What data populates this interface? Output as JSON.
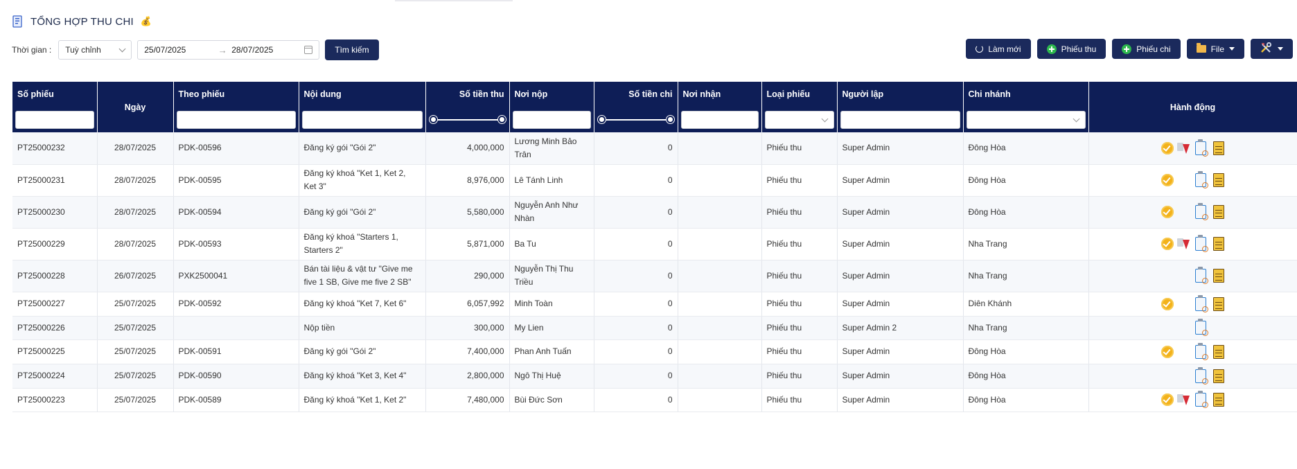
{
  "page": {
    "title": "TỔNG HỢP THU CHI",
    "title_emoji": "💰"
  },
  "filter": {
    "label": "Thời gian :",
    "period": "Tuỳ chỉnh",
    "date_from": "25/07/2025",
    "date_to": "28/07/2025",
    "arrow": "→",
    "search_label": "Tìm kiếm"
  },
  "toolbar": {
    "refresh_label": "Làm mới",
    "receipt_label": "Phiếu thu",
    "payment_label": "Phiếu chi",
    "file_label": "File"
  },
  "table": {
    "columns": [
      "Số phiếu",
      "Ngày",
      "Theo phiếu",
      "Nội dung",
      "Số tiền thu",
      "Nơi nộp",
      "Số tiền chi",
      "Nơi nhận",
      "Loại phiếu",
      "Người lập",
      "Chi nhánh",
      "Hành động"
    ],
    "rows": [
      {
        "so_phieu": "PT25000232",
        "ngay": "28/07/2025",
        "theo_phieu": "PDK-00596",
        "noi_dung": "Đăng ký gói \"Gói 2\"",
        "thu": "4,000,000",
        "noi_nop": "Lương Minh Bảo Trân",
        "chi": "0",
        "noi_nhan": "",
        "loai": "Phiếu thu",
        "nguoi_lap": "Super Admin",
        "chi_nhanh": "Đông Hòa",
        "actions": [
          "approve-icon",
          "download-icon",
          "clipboard-icon",
          "document-icon"
        ]
      },
      {
        "so_phieu": "PT25000231",
        "ngay": "28/07/2025",
        "theo_phieu": "PDK-00595",
        "noi_dung": "Đăng ký khoá \"Ket 1, Ket 2, Ket 3\"",
        "thu": "8,976,000",
        "noi_nop": "Lê Tánh Linh",
        "chi": "0",
        "noi_nhan": "",
        "loai": "Phiếu thu",
        "nguoi_lap": "Super Admin",
        "chi_nhanh": "Đông Hòa",
        "actions": [
          "approve-icon",
          "clipboard-icon",
          "document-icon"
        ]
      },
      {
        "so_phieu": "PT25000230",
        "ngay": "28/07/2025",
        "theo_phieu": "PDK-00594",
        "noi_dung": "Đăng ký gói \"Gói 2\"",
        "thu": "5,580,000",
        "noi_nop": "Nguyễn Anh Như Nhàn",
        "chi": "0",
        "noi_nhan": "",
        "loai": "Phiếu thu",
        "nguoi_lap": "Super Admin",
        "chi_nhanh": "Đông Hòa",
        "actions": [
          "approve-icon",
          "clipboard-icon",
          "document-icon"
        ]
      },
      {
        "so_phieu": "PT25000229",
        "ngay": "28/07/2025",
        "theo_phieu": "PDK-00593",
        "noi_dung": "Đăng ký khoá \"Starters 1, Starters 2\"",
        "thu": "5,871,000",
        "noi_nop": "Ba Tu",
        "chi": "0",
        "noi_nhan": "",
        "loai": "Phiếu thu",
        "nguoi_lap": "Super Admin",
        "chi_nhanh": "Nha Trang",
        "actions": [
          "approve-icon",
          "download-icon",
          "clipboard-icon",
          "document-icon"
        ]
      },
      {
        "so_phieu": "PT25000228",
        "ngay": "26/07/2025",
        "theo_phieu": "PXK2500041",
        "noi_dung": "Bán tài liệu & vật tư \"Give me five 1 SB, Give me five 2 SB\"",
        "thu": "290,000",
        "noi_nop": "Nguyễn Thị Thu Triều",
        "chi": "0",
        "noi_nhan": "",
        "loai": "Phiếu thu",
        "nguoi_lap": "Super Admin",
        "chi_nhanh": "Nha Trang",
        "actions": [
          "clipboard-icon",
          "document-icon"
        ]
      },
      {
        "so_phieu": "PT25000227",
        "ngay": "25/07/2025",
        "theo_phieu": "PDK-00592",
        "noi_dung": "Đăng ký khoá \"Ket 7, Ket 6\"",
        "thu": "6,057,992",
        "noi_nop": "Minh Toàn",
        "chi": "0",
        "noi_nhan": "",
        "loai": "Phiếu thu",
        "nguoi_lap": "Super Admin",
        "chi_nhanh": "Diên Khánh",
        "actions": [
          "approve-icon",
          "clipboard-icon",
          "document-icon"
        ]
      },
      {
        "so_phieu": "PT25000226",
        "ngay": "25/07/2025",
        "theo_phieu": "",
        "noi_dung": "Nộp tiền",
        "thu": "300,000",
        "noi_nop": "My Lien",
        "chi": "0",
        "noi_nhan": "",
        "loai": "Phiếu thu",
        "nguoi_lap": "Super Admin 2",
        "chi_nhanh": "Nha Trang",
        "actions": [
          "clipboard-icon"
        ]
      },
      {
        "so_phieu": "PT25000225",
        "ngay": "25/07/2025",
        "theo_phieu": "PDK-00591",
        "noi_dung": "Đăng ký gói \"Gói 2\"",
        "thu": "7,400,000",
        "noi_nop": "Phan Anh Tuấn",
        "chi": "0",
        "noi_nhan": "",
        "loai": "Phiếu thu",
        "nguoi_lap": "Super Admin",
        "chi_nhanh": "Đông Hòa",
        "actions": [
          "approve-icon",
          "clipboard-icon",
          "document-icon"
        ]
      },
      {
        "so_phieu": "PT25000224",
        "ngay": "25/07/2025",
        "theo_phieu": "PDK-00590",
        "noi_dung": "Đăng ký khoá \"Ket 3, Ket 4\"",
        "thu": "2,800,000",
        "noi_nop": "Ngô Thị Huệ",
        "chi": "0",
        "noi_nhan": "",
        "loai": "Phiếu thu",
        "nguoi_lap": "Super Admin",
        "chi_nhanh": "Đông Hòa",
        "actions": [
          "clipboard-icon",
          "document-icon"
        ]
      },
      {
        "so_phieu": "PT25000223",
        "ngay": "25/07/2025",
        "theo_phieu": "PDK-00589",
        "noi_dung": "Đăng ký khoá \"Ket 1, Ket 2\"",
        "thu": "7,480,000",
        "noi_nop": "Bùi Đức Sơn",
        "chi": "0",
        "noi_nhan": "",
        "loai": "Phiếu thu",
        "nguoi_lap": "Super Admin",
        "chi_nhanh": "Đông Hòa",
        "actions": [
          "approve-icon",
          "download-icon",
          "clipboard-icon",
          "document-icon"
        ]
      }
    ]
  }
}
